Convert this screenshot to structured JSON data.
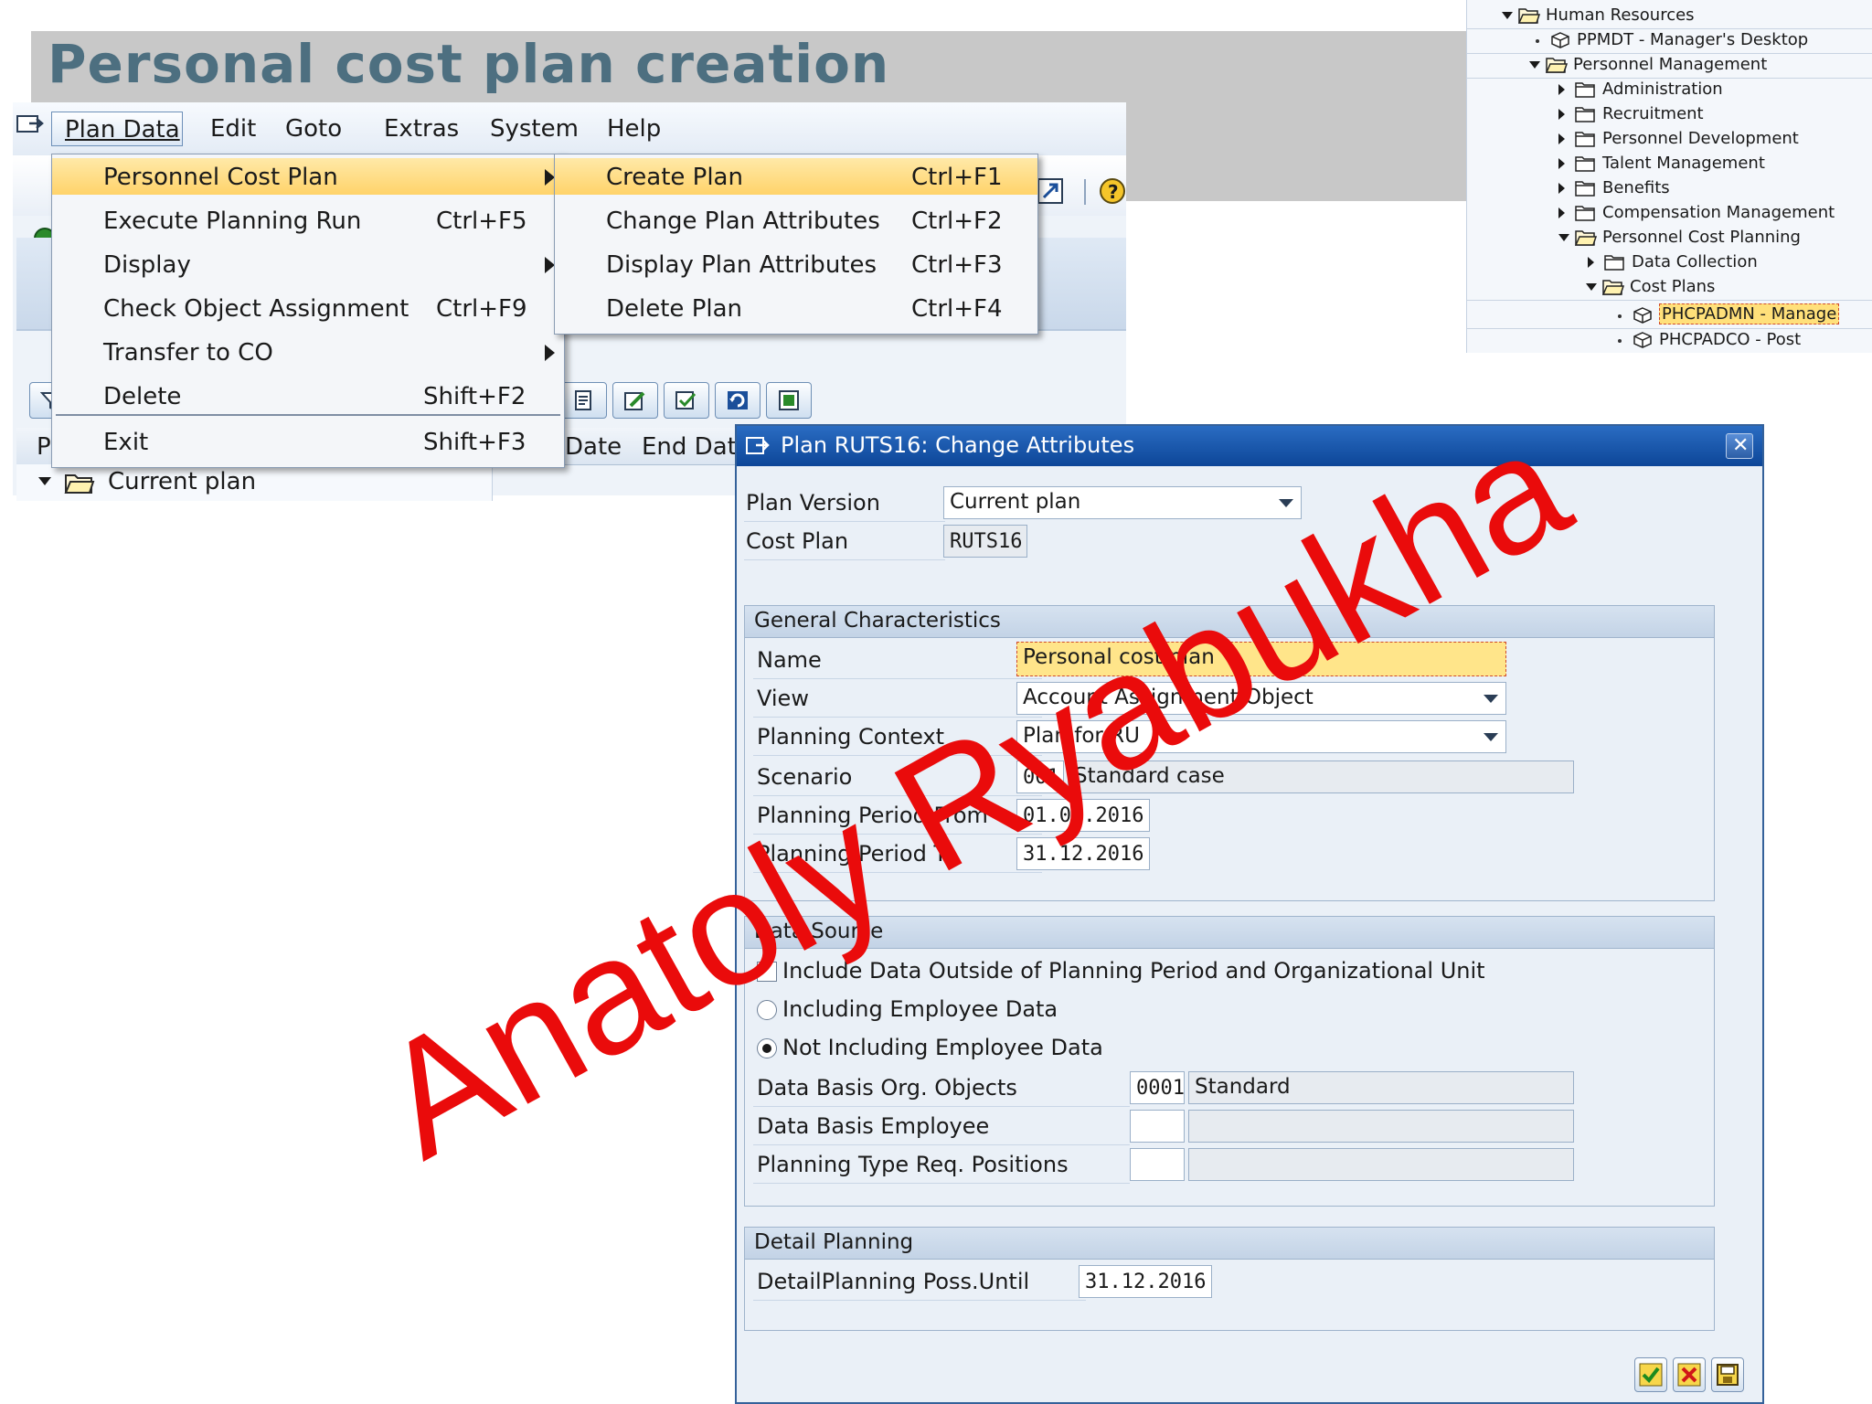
{
  "slide": {
    "title": "Personal cost plan creation",
    "watermark": "Anatoly Ryabukha"
  },
  "menubar": {
    "items": [
      {
        "label": "Plan Data"
      },
      {
        "label": "Edit"
      },
      {
        "label": "Goto"
      },
      {
        "label": "Extras"
      },
      {
        "label": "System"
      },
      {
        "label": "Help"
      }
    ]
  },
  "plan_data_menu": {
    "items": [
      {
        "label": "Personnel Cost Plan",
        "shortcut": "",
        "submenu": true,
        "highlighted": true
      },
      {
        "label": "Execute Planning Run",
        "shortcut": "Ctrl+F5",
        "submenu": false
      },
      {
        "label": "Display",
        "shortcut": "",
        "submenu": true
      },
      {
        "label": "Check Object Assignment",
        "shortcut": "Ctrl+F9",
        "submenu": false
      },
      {
        "label": "Transfer to CO",
        "shortcut": "",
        "submenu": true
      },
      {
        "label": "Delete",
        "shortcut": "Shift+F2",
        "submenu": false
      },
      {
        "label": "Exit",
        "shortcut": "Shift+F3",
        "submenu": false
      }
    ]
  },
  "cost_plan_submenu": {
    "items": [
      {
        "label": "Create Plan",
        "shortcut": "Ctrl+F1",
        "highlighted": true
      },
      {
        "label": "Change Plan Attributes",
        "shortcut": "Ctrl+F2"
      },
      {
        "label": "Display Plan Attributes",
        "shortcut": "Ctrl+F3"
      },
      {
        "label": "Delete Plan",
        "shortcut": "Ctrl+F4"
      }
    ]
  },
  "main_list": {
    "columns": [
      "P",
      "Date",
      "End Date"
    ],
    "tree_root": "Current plan"
  },
  "hr_tree": {
    "nodes": [
      {
        "label": "Human Resources"
      },
      {
        "label": "PPMDT - Manager's Desktop"
      },
      {
        "label": "Personnel Management"
      },
      {
        "label": "Administration"
      },
      {
        "label": "Recruitment"
      },
      {
        "label": "Personnel Development"
      },
      {
        "label": "Talent Management"
      },
      {
        "label": "Benefits"
      },
      {
        "label": "Compensation Management"
      },
      {
        "label": "Personnel Cost Planning"
      },
      {
        "label": "Data Collection"
      },
      {
        "label": "Cost Plans"
      },
      {
        "label": "PHCPADMN - Manage"
      },
      {
        "label": "PHCPADCO - Post"
      }
    ]
  },
  "dialog": {
    "title": "Plan RUTS16: Change Attributes",
    "plan_version": {
      "label": "Plan Version",
      "value": "Current plan"
    },
    "cost_plan": {
      "label": "Cost Plan",
      "value": "RUTS16"
    },
    "general": {
      "header": "General Characteristics",
      "name": {
        "label": "Name",
        "value": "Personal cost plan"
      },
      "view": {
        "label": "View",
        "value": "Account Assignment Object"
      },
      "context": {
        "label": "Planning Context",
        "value": "Plan for RU"
      },
      "scenario": {
        "label": "Scenario",
        "code": "001",
        "text": "Standard case"
      },
      "period_from": {
        "label": "Planning Period From",
        "value": "01.01.2016"
      },
      "period_to": {
        "label": "Planning Period To",
        "value": "31.12.2016"
      }
    },
    "data_source": {
      "header": "Data Source",
      "include_outside": {
        "label": "Include Data Outside of Planning Period and Organizational Unit",
        "checked": false
      },
      "incl_employee": {
        "label": "Including Employee Data",
        "selected": false
      },
      "not_incl_employee": {
        "label": "Not Including Employee Data",
        "selected": true
      },
      "org_objects": {
        "label": "Data Basis Org. Objects",
        "code": "0001",
        "text": "Standard"
      },
      "employee": {
        "label": "Data Basis Employee",
        "code": "",
        "text": ""
      },
      "type_req": {
        "label": "Planning Type Req. Positions",
        "code": "",
        "text": ""
      }
    },
    "detail": {
      "header": "Detail Planning",
      "until": {
        "label": "DetailPlanning Poss.Until",
        "value": "31.12.2016"
      }
    }
  }
}
